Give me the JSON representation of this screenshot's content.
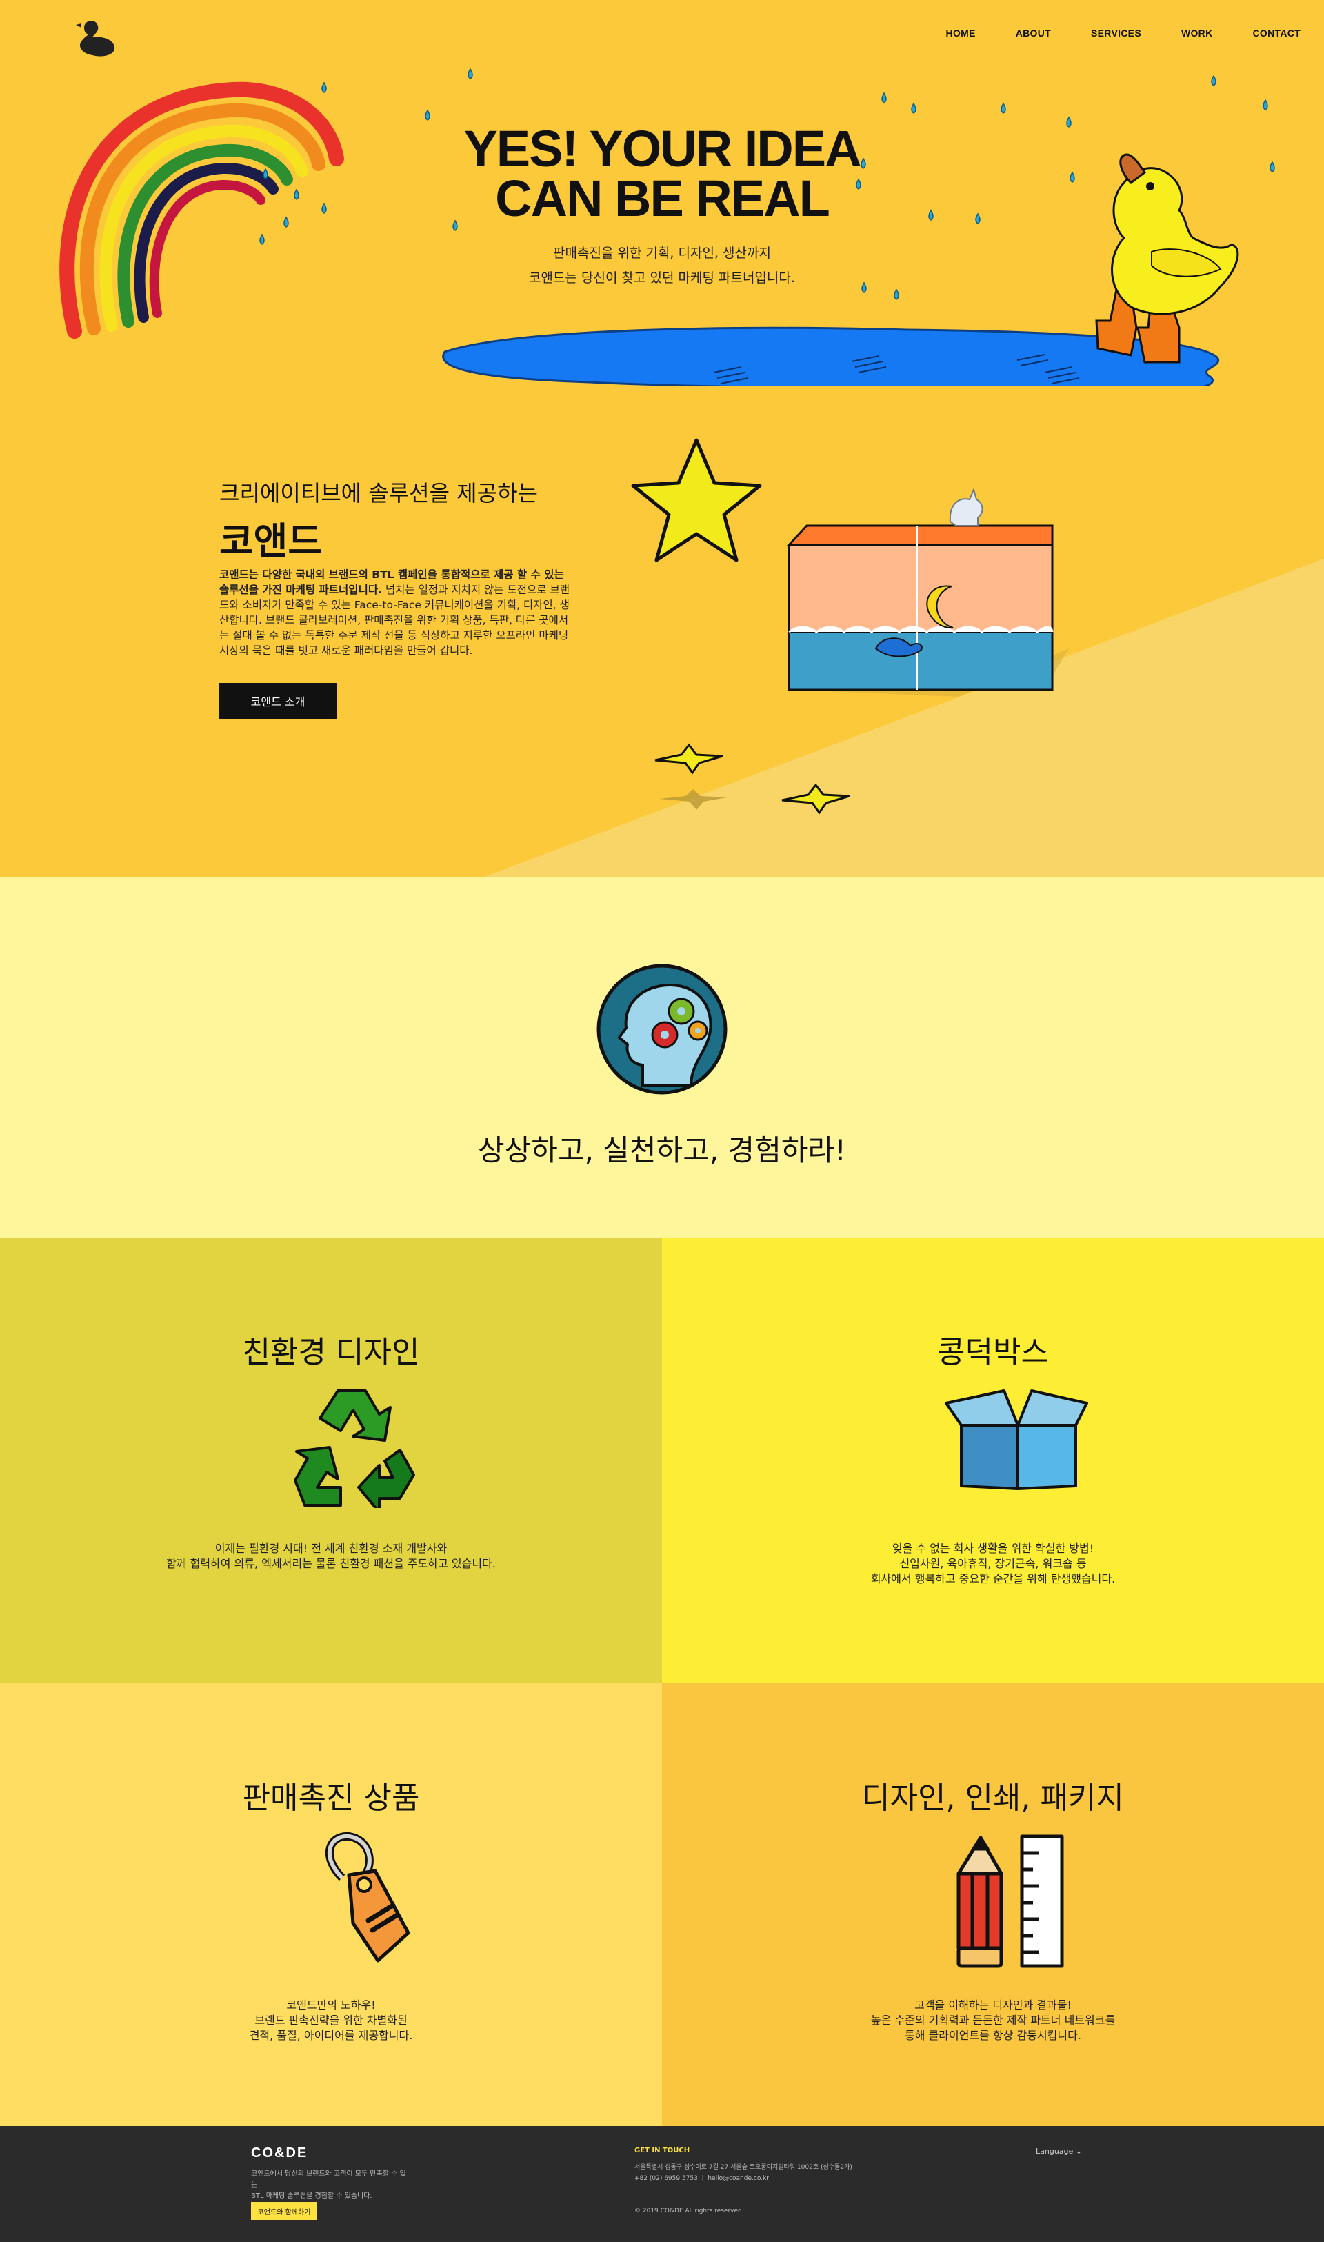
{
  "nav": {
    "logo_icon": "duck-ampersand-icon",
    "items": [
      {
        "label": "HOME"
      },
      {
        "label": "ABOUT"
      },
      {
        "label": "SERVICES"
      },
      {
        "label": "WORK"
      },
      {
        "label": "CONTACT"
      }
    ]
  },
  "hero": {
    "title_line1": "YES! YOUR IDEA",
    "title_line2": "CAN BE REAL",
    "subtitle_line1": "판매촉진을 위한 기획, 디자인, 생산까지",
    "subtitle_line2": "코앤드는 당신이 찾고 있던 마케팅 파트너입니다."
  },
  "intro": {
    "kicker": "크리에이티브에 솔루션을 제공하는",
    "title": "코앤드",
    "text_bold": "코앤드는 다양한 국내외 브랜드의 BTL 캠페인을 통합적으로 제공 할 수 있는 솔루션을 가진 마케팅 파트너입니다.",
    "text_rest": " 넘치는 열정과 지치지 않는 도전으로 브랜드와 소비자가 만족할 수 있는 Face-to-Face 커뮤니케이션을 기획, 디자인, 생산합니다. 브랜드 콜라보레이션, 판매촉진을 위한 기획 상품, 특판, 다른 곳에서는 절대 볼 수 없는 독특한 주문 제작 선물 등 식상하고 지루한 오프라인 마케팅 시장의 묵은 때를 벗고 새로운 패러다임을 만들어 갑니다.",
    "button_label": "코앤드 소개"
  },
  "motto": {
    "icon": "head-gears-icon",
    "title": "상상하고, 실천하고, 경험하라!"
  },
  "services": [
    {
      "title": "친환경 디자인",
      "icon": "recycle-icon",
      "bg": "#e2d340",
      "lines": [
        "이제는 필환경 시대! 전 세계 친환경 소재 개발사와",
        "함께 협력하여 의류, 엑세서리는 물론 친환경 패션을 주도하고 있습니다."
      ]
    },
    {
      "title": "콩덕박스",
      "icon": "open-box-icon",
      "bg": "#fdee35",
      "lines": [
        "잊을 수 없는 회사 생활을 위한 확실한 방법!",
        "신입사원, 육아휴직, 장기근속, 워크숍 등",
        "회사에서 행복하고 중요한 순간을 위해 탄생했습니다."
      ]
    },
    {
      "title": "판매촉진 상품",
      "icon": "price-tag-icon",
      "bg": "#fedd60",
      "lines": [
        "코앤드만의 노하우!",
        "브랜드 판촉전략을 위한 차별화된",
        "견적, 품질, 아이디어를 제공합니다."
      ]
    },
    {
      "title": "디자인, 인쇄, 패키지",
      "icon": "pencil-ruler-icon",
      "bg": "#fac63f",
      "lines": [
        "고객을 이해하는 디자인과 결과물!",
        "높은 수준의 기획력과 든든한 제작 파트너 네트워크를",
        "통해 클라이언트를 항상 감동시킵니다."
      ]
    }
  ],
  "footer": {
    "logo": "CO&DE",
    "desc_line1": "코앤드에서 당신의 브랜드와 고객이 모두 만족할 수 있는",
    "desc_line2": "BTL 마케팅 솔루션을 경험할 수 있습니다.",
    "button_label": "코앤드와 함께하기",
    "contact_heading": "GET IN TOUCH",
    "address": "서울특별시 성동구 성수이로 7길 27 서울숲 코오롱디지털타워 1002호 (성수동2가)",
    "phone": "+82 (02) 6959 5753",
    "email": "hello@coande.co.kr",
    "copyright": "© 2019 CO&DE All rights reserved.",
    "language_label": "Language"
  },
  "colors": {
    "hero_bg": "#fcc93a",
    "motto_bg": "#fff59b",
    "footer_bg": "#2b2b2b",
    "accent_yellow": "#fde140"
  }
}
